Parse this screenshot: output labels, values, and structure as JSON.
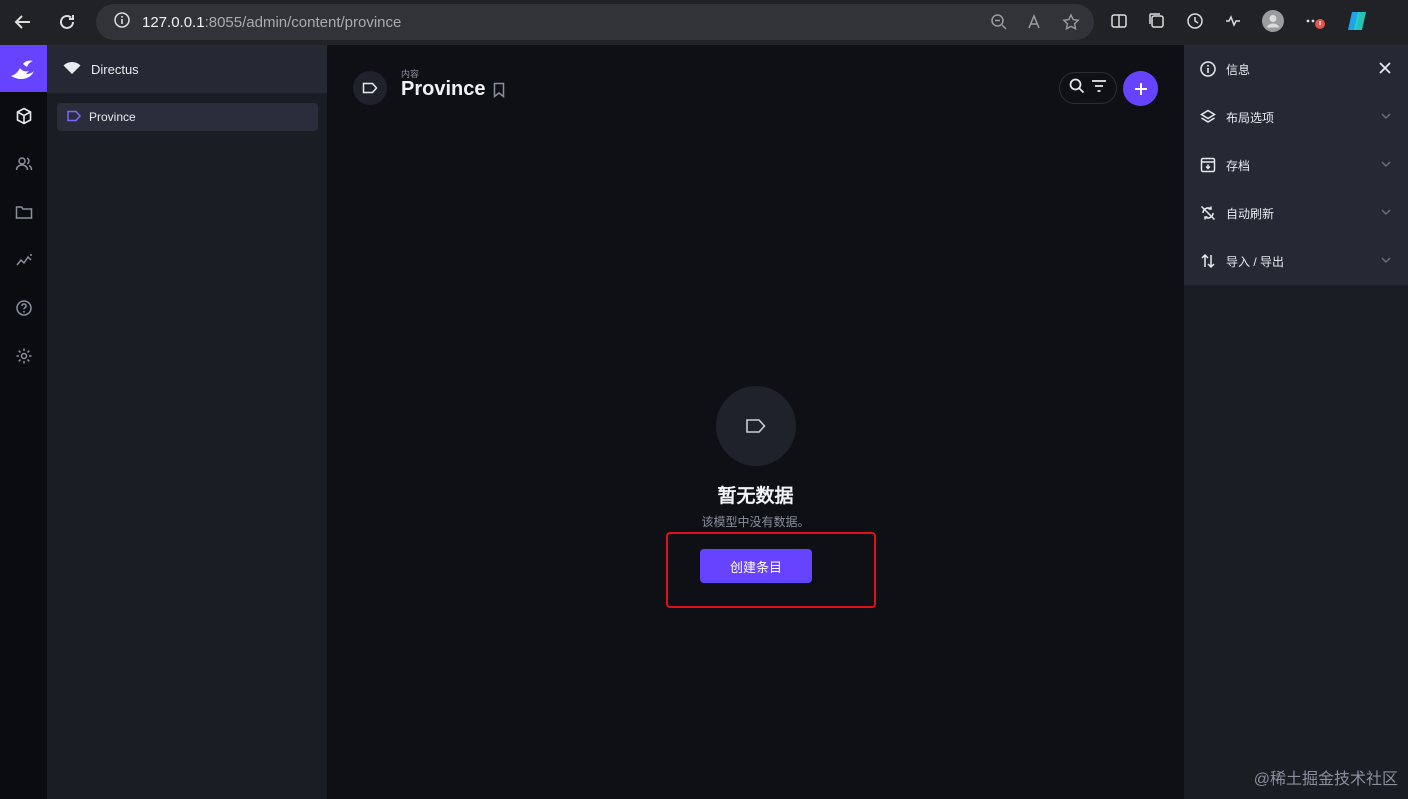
{
  "browser": {
    "url_host": "127.0.0.1",
    "url_path": ":8055/admin/content/province"
  },
  "nav": {
    "project_name": "Directus",
    "items": [
      {
        "label": "Province"
      }
    ]
  },
  "header": {
    "breadcrumb": "内容",
    "title": "Province"
  },
  "empty_state": {
    "title": "暂无数据",
    "subtitle": "该模型中没有数据。",
    "button_label": "创建条目"
  },
  "sidebar": {
    "sections": [
      {
        "label": "信息",
        "icon": "info-icon"
      },
      {
        "label": "布局选项",
        "icon": "layers-icon"
      },
      {
        "label": "存档",
        "icon": "archive-icon"
      },
      {
        "label": "自动刷新",
        "icon": "sync-off-icon"
      },
      {
        "label": "导入 / 导出",
        "icon": "import-export-icon"
      }
    ]
  },
  "watermark": "@稀土掘金技术社区",
  "colors": {
    "accent": "#6644ff",
    "highlight": "#e01018"
  }
}
